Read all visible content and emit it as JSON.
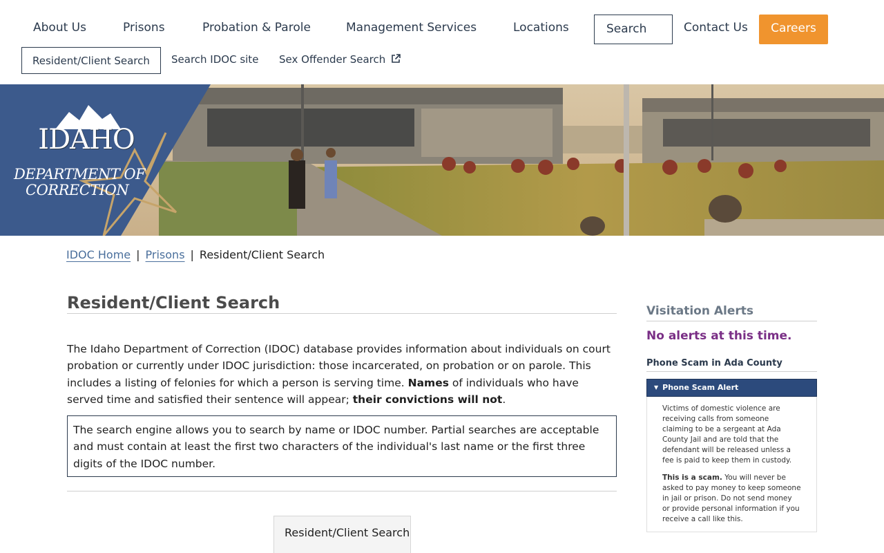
{
  "nav": {
    "items": [
      "About Us",
      "Prisons",
      "Probation & Parole",
      "Management Services",
      "Locations"
    ],
    "search_label": "Search",
    "contact_label": "Contact Us",
    "careers_label": "Careers"
  },
  "subnav": {
    "active": "Resident/Client Search",
    "items": [
      "Search IDOC site",
      "Sex Offender Search"
    ]
  },
  "logo": {
    "line1": "IDAHO",
    "line2": "DEPARTMENT OF",
    "line3": "CORRECTION"
  },
  "breadcrumb": {
    "home": "IDOC Home",
    "prisons": "Prisons",
    "current": "Resident/Client Search",
    "separator": "|"
  },
  "main": {
    "title": "Resident/Client Search",
    "intro_a": "The Idaho Department of Correction (IDOC) database provides information about individuals on court probation or currently under IDOC jurisdiction: those incarcerated, on probation or on parole. This includes a listing of felonies for which a person is serving time. ",
    "intro_names": "Names",
    "intro_b": " of individuals who have served time and satisfied their sentence will appear; ",
    "intro_convictions": "their convictions will not",
    "intro_c": ".",
    "note": "The search engine allows you to search by name or IDOC number. Partial searches are acceptable and must contain at least the first two characters of the individual's last name or the first three digits of the IDOC number.",
    "tab_label": "Resident/Client Search"
  },
  "sidebar": {
    "visitation_heading": "Visitation Alerts",
    "no_alerts": "No alerts at this time.",
    "scam_heading": "Phone Scam in Ada County",
    "accordion_title": "Phone Scam Alert",
    "accordion_p1": "Victims of domestic violence are receiving calls from someone claiming to be a sergeant at Ada County Jail and are told that the defendant will be released unless a fee is paid to keep them in custody.",
    "accordion_p2_bold": "This is a scam.",
    "accordion_p2": " You will never be asked to pay money to keep someone in jail or prison. Do not send money or provide personal information if you receive a call like this."
  },
  "colors": {
    "nav_text": "#2b3a4d",
    "careers_bg": "#f0942e",
    "logo_panel": "#3c5a8c",
    "alert_purple": "#7a2f86",
    "accordion_header": "#2c4a7c"
  }
}
